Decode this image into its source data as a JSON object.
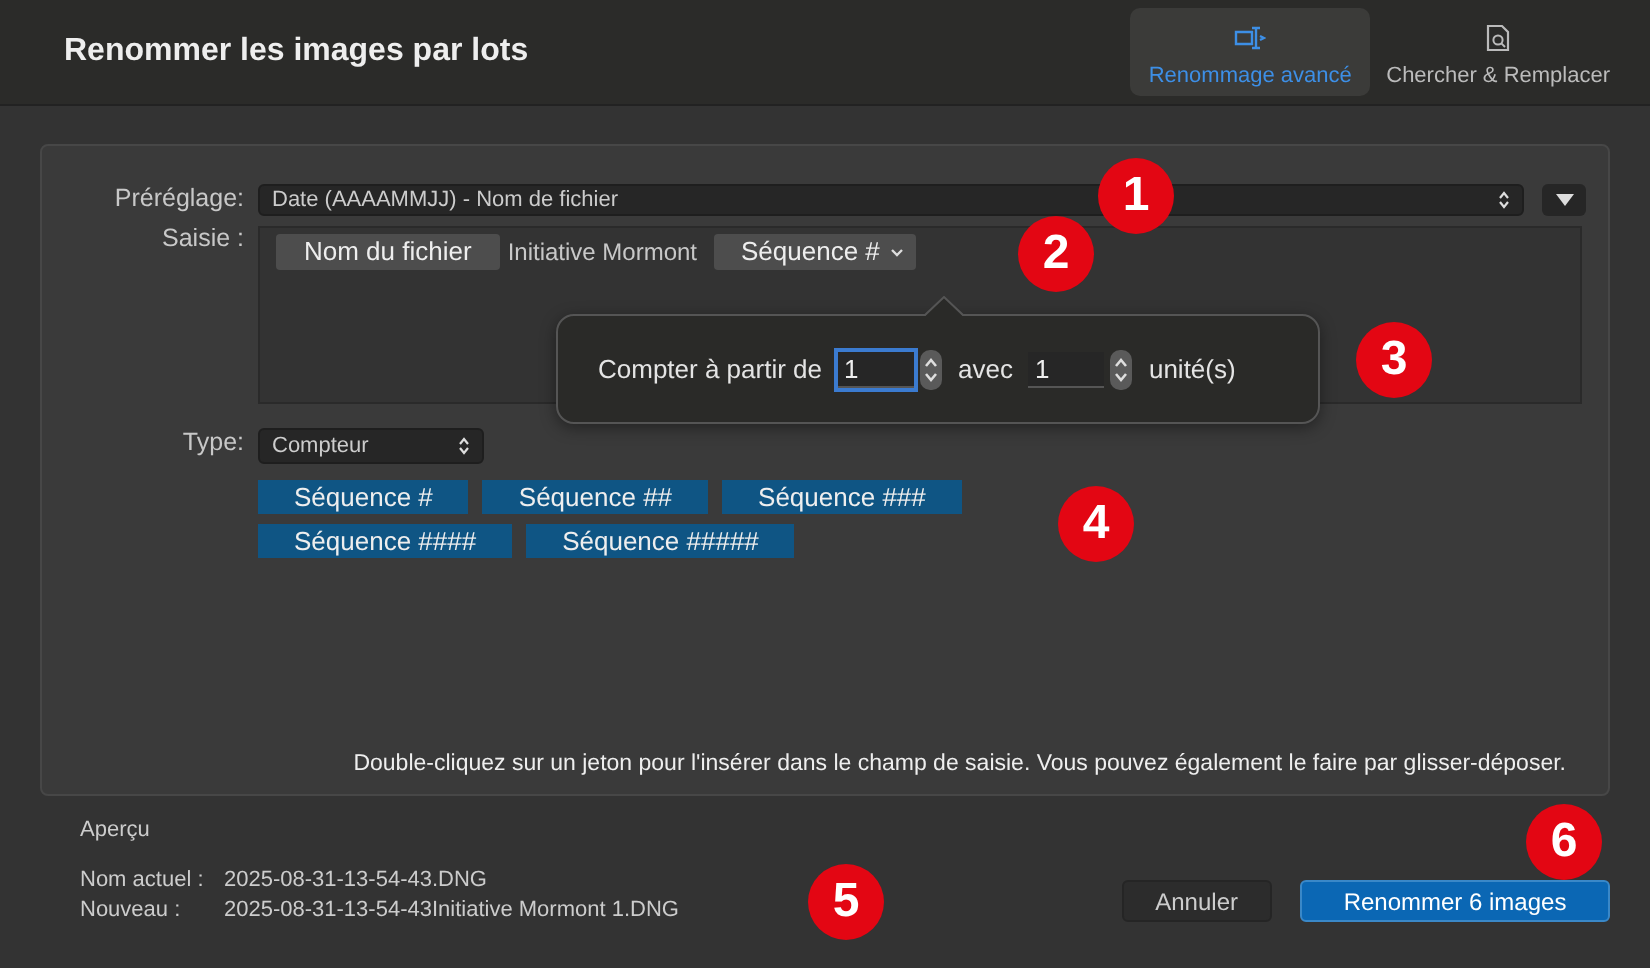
{
  "window": {
    "title": "Renommer les images par lots"
  },
  "tabs": [
    {
      "label": "Renommage avancé",
      "selected": true
    },
    {
      "label": "Chercher & Remplacer",
      "selected": false
    }
  ],
  "preset": {
    "label": "Préréglage:",
    "value": "Date (AAAAMMJJ) - Nom de fichier"
  },
  "input": {
    "label": "Saisie :",
    "tokens": [
      {
        "kind": "token",
        "text": "Nom du fichier"
      },
      {
        "kind": "text",
        "text": "Initiative Mormont"
      },
      {
        "kind": "menu-token",
        "text": "Séquence #"
      }
    ]
  },
  "popover": {
    "start_label": "Compter à partir de",
    "start_value": "1",
    "with_label": "avec",
    "step_value": "1",
    "unit_label": "unité(s)"
  },
  "type": {
    "label": "Type:",
    "value": "Compteur"
  },
  "token_palette": [
    "Séquence #",
    "Séquence ##",
    "Séquence ###",
    "Séquence ####",
    "Séquence #####"
  ],
  "hint": "Double-cliquez sur un jeton pour l'insérer dans le champ de saisie. Vous pouvez également le faire par glisser-déposer.",
  "preview": {
    "title": "Aperçu",
    "rows": [
      {
        "label": "Nom actuel :",
        "value": "2025-08-31-13-54-43.DNG"
      },
      {
        "label": "Nouveau :",
        "value": "2025-08-31-13-54-43Initiative Mormont 1.DNG"
      }
    ]
  },
  "buttons": [
    {
      "label": "Annuler",
      "kind": "secondary"
    },
    {
      "label": "Renommer 6 images",
      "kind": "primary"
    }
  ],
  "callouts": [
    "1",
    "2",
    "3",
    "4",
    "5",
    "6"
  ]
}
